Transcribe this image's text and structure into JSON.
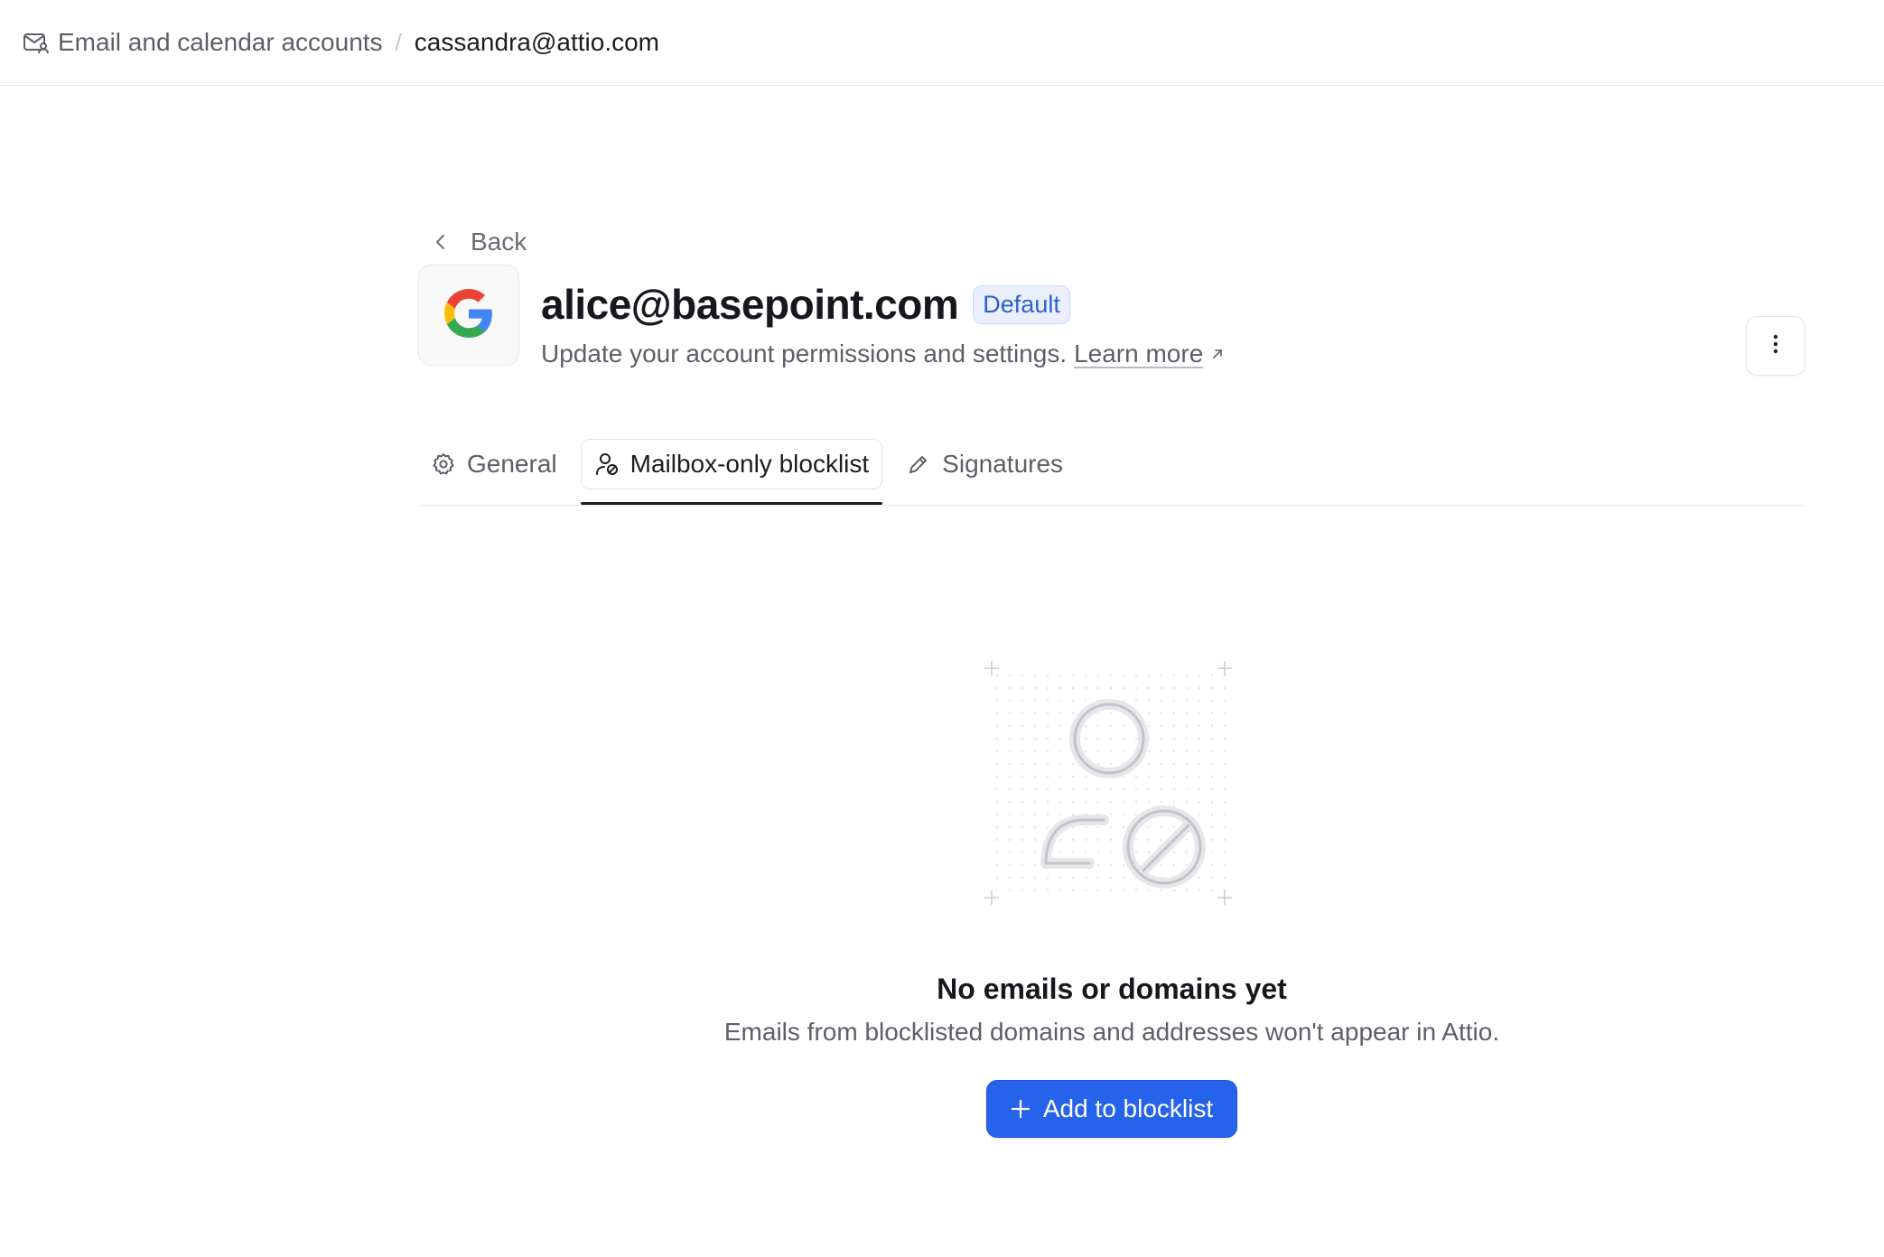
{
  "breadcrumb": {
    "parent": "Email and calendar accounts",
    "separator": "/",
    "current": "cassandra@attio.com"
  },
  "back": {
    "label": "Back"
  },
  "account": {
    "email": "alice@basepoint.com",
    "badge": "Default",
    "subtitle": "Update your account permissions and settings.",
    "learn_more": "Learn more",
    "provider_icon": "google-icon"
  },
  "tabs": [
    {
      "label": "General",
      "icon": "gear-icon",
      "active": false
    },
    {
      "label": "Mailbox-only blocklist",
      "icon": "user-blocked-icon",
      "active": true
    },
    {
      "label": "Signatures",
      "icon": "pencil-icon",
      "active": false
    }
  ],
  "empty_state": {
    "title": "No emails or domains yet",
    "description": "Emails from blocklisted domains and addresses won't appear in Attio.",
    "button_label": "Add to blocklist"
  },
  "colors": {
    "primary": "#2563eb",
    "badge_text": "#2d5fcf",
    "badge_bg": "#e9effd"
  }
}
